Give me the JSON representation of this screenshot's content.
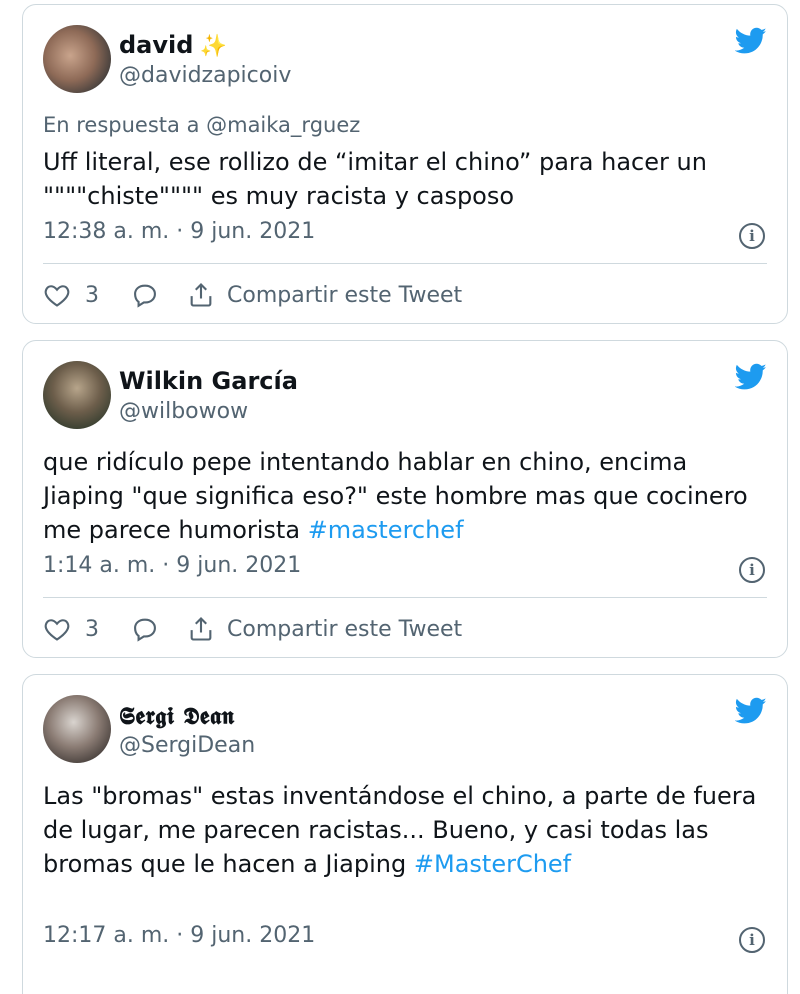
{
  "colors": {
    "accent": "#1d9bf0",
    "muted": "#536471",
    "text": "#0f1419",
    "border": "#cfd9de"
  },
  "tweets": [
    {
      "name": "david",
      "name_emoji": "✨",
      "handle": "@davidzapicoiv",
      "reply_to": "En respuesta a @maika_rguez",
      "text": "Uff literal, ese rollizo de “imitar el chino” para hacer un \"\"\"\"chiste\"\"\"\" es muy racista y casposo",
      "timestamp": "12:38 a. m. · 9 jun. 2021",
      "likes": "3",
      "share_label": "Compartir este Tweet"
    },
    {
      "name": "Wilkin García",
      "handle": "@wilbowow",
      "text_before": "que ridículo pepe intentando hablar en chino, encima Jiaping \"que significa eso?\" este hombre mas que cocinero me parece humorista ",
      "hashtag": "#masterchef",
      "timestamp": "1:14 a. m. · 9 jun. 2021",
      "likes": "3",
      "share_label": "Compartir este Tweet"
    },
    {
      "name": "𝕾𝖊𝖗𝖌𝖎 𝕯𝖊𝖆𝖓",
      "handle": "@SergiDean",
      "text_before": "Las \"bromas\" estas inventándose el chino, a parte de fuera de lugar, me parecen racistas... Bueno, y casi todas las bromas que le hacen a Jiaping ",
      "hashtag": "#MasterChef",
      "timestamp": "12:17 a. m. · 9 jun. 2021"
    }
  ],
  "icons": {
    "brand": "twitter-bird-icon",
    "info": "info-icon",
    "like": "heart-icon",
    "reply": "reply-bubble-icon",
    "share": "share-icon"
  }
}
